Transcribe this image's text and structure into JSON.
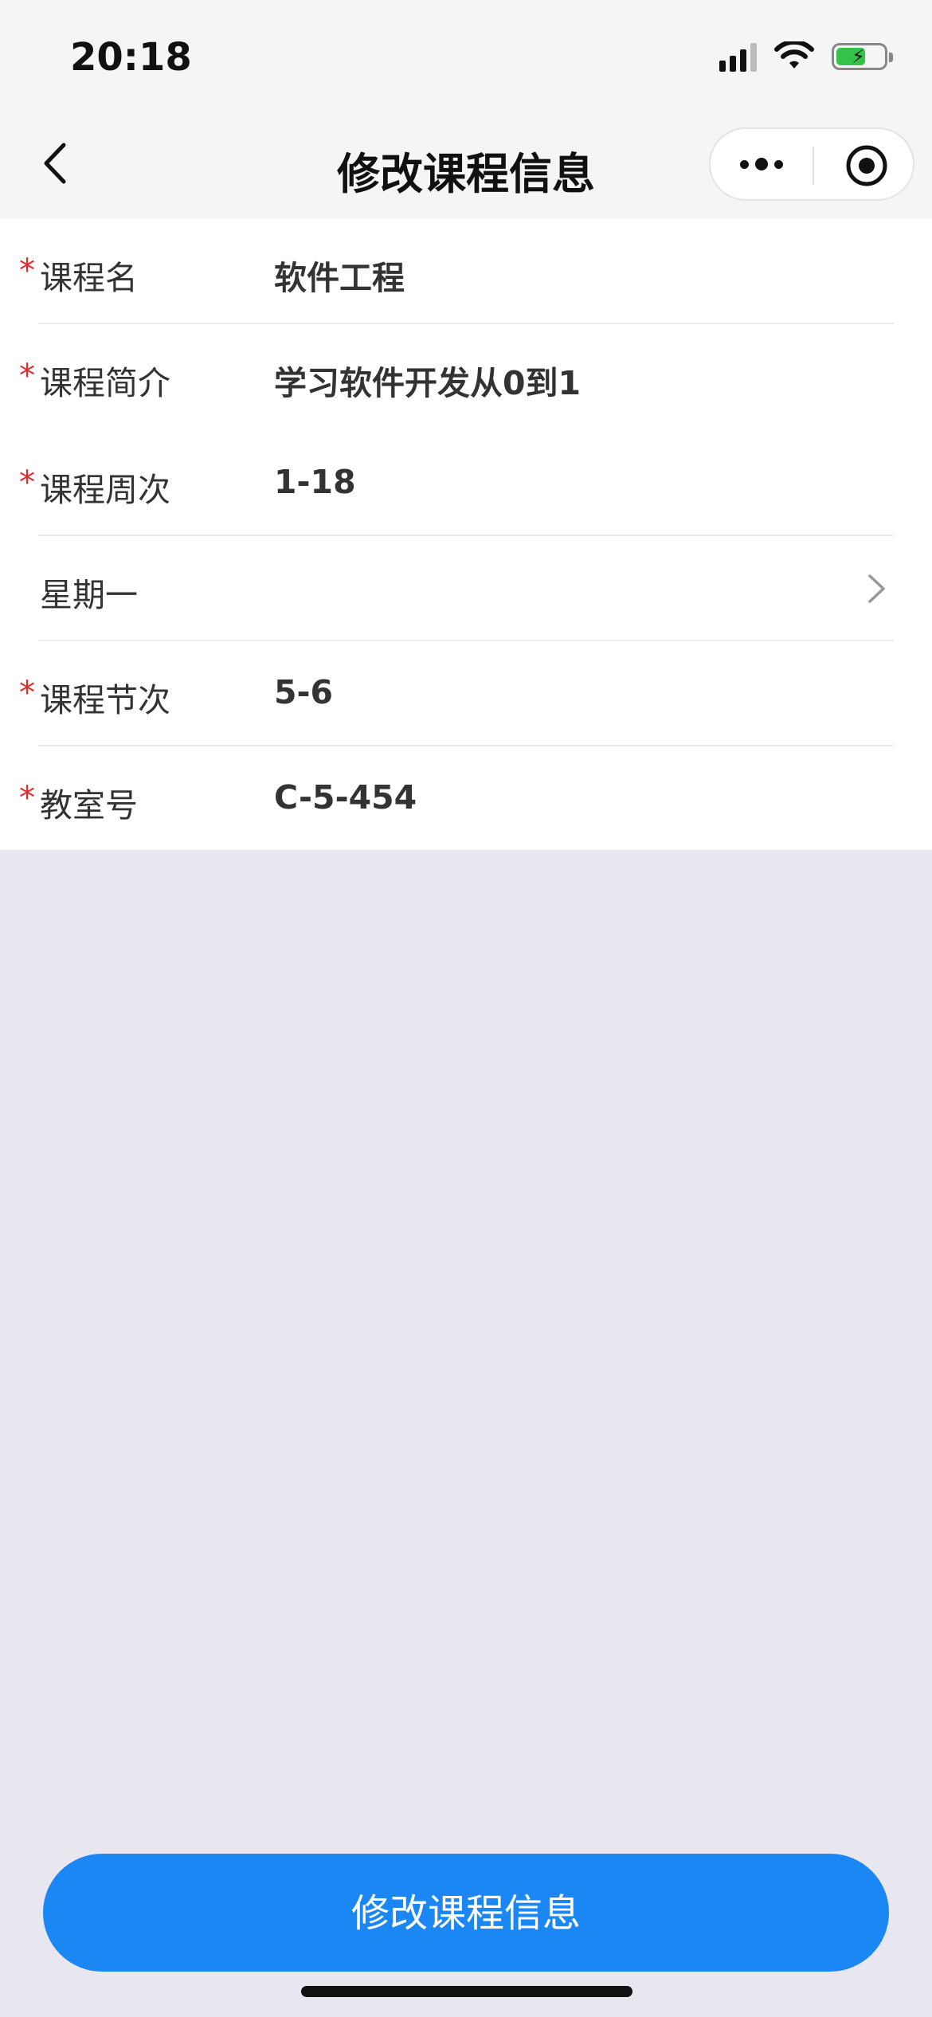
{
  "status_bar": {
    "time": "20:18"
  },
  "nav": {
    "title": "修改课程信息"
  },
  "form": {
    "rows": [
      {
        "label": "课程名",
        "value": "软件工程",
        "required": true
      },
      {
        "label": "课程简介",
        "value": "学习软件开发从0到1",
        "required": true
      },
      {
        "label": "课程周次",
        "value": "1-18",
        "required": true
      },
      {
        "label": "星期一",
        "value": "",
        "required": false
      },
      {
        "label": "课程节次",
        "value": "5-6",
        "required": true
      },
      {
        "label": "教室号",
        "value": "C-5-454",
        "required": true
      }
    ]
  },
  "submit_label": "修改课程信息",
  "colors": {
    "accent": "#1b87f5",
    "required": "#e02c2c",
    "background": "#e8e6ee"
  },
  "icons": [
    "back-icon",
    "more-icon",
    "close-target-icon",
    "chevron-right-icon",
    "signal-icon",
    "wifi-icon",
    "battery-icon"
  ]
}
